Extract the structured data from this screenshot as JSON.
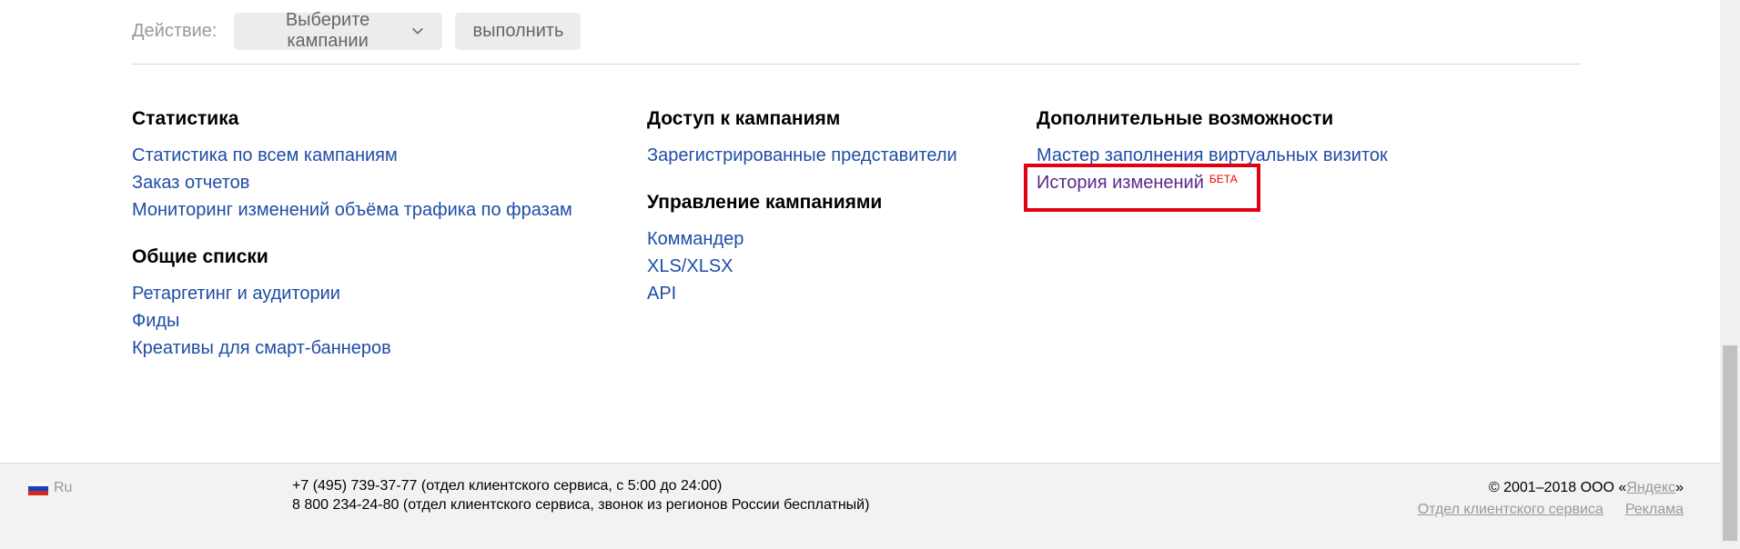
{
  "action_bar": {
    "label": "Действие:",
    "select_label": "Выберите кампании",
    "run_label": "выполнить"
  },
  "columns": [
    {
      "sections": [
        {
          "title": "Статистика",
          "links": [
            "Статистика по всем кампаниям",
            "Заказ отчетов",
            "Мониторинг изменений объёма трафика по фразам"
          ]
        },
        {
          "title": "Общие списки",
          "links": [
            "Ретаргетинг и аудитории",
            "Фиды",
            "Креативы для смарт-баннеров"
          ]
        }
      ]
    },
    {
      "sections": [
        {
          "title": "Доступ к кампаниям",
          "links": [
            "Зарегистрированные представители"
          ]
        },
        {
          "title": "Управление кампаниями",
          "links": [
            "Коммандер",
            "XLS/XLSX",
            "API"
          ]
        }
      ]
    },
    {
      "sections": [
        {
          "title": "Дополнительные возможности",
          "links": [
            "Мастер заполнения виртуальных визиток"
          ],
          "highlighted_link": "История изменений",
          "highlighted_badge": "БЕТА"
        }
      ]
    }
  ],
  "footer": {
    "language": "Ru",
    "phone_line_1": "+7 (495) 739-37-77 (отдел клиентского сервиса, с 5:00 до 24:00)",
    "phone_line_2": "8 800 234-24-80 (отдел клиентского сервиса, звонок из регионов России бесплатный)",
    "copyright_prefix": "© 2001–2018  ООО «",
    "copyright_company": "Яндекс",
    "copyright_suffix": "»",
    "link_service": "Отдел клиентского сервиса",
    "link_ads": "Реклама"
  },
  "colors": {
    "link": "#1e4da6",
    "visited_link": "#5b2a8c",
    "highlight": "#e00012",
    "badge": "#e00000"
  }
}
